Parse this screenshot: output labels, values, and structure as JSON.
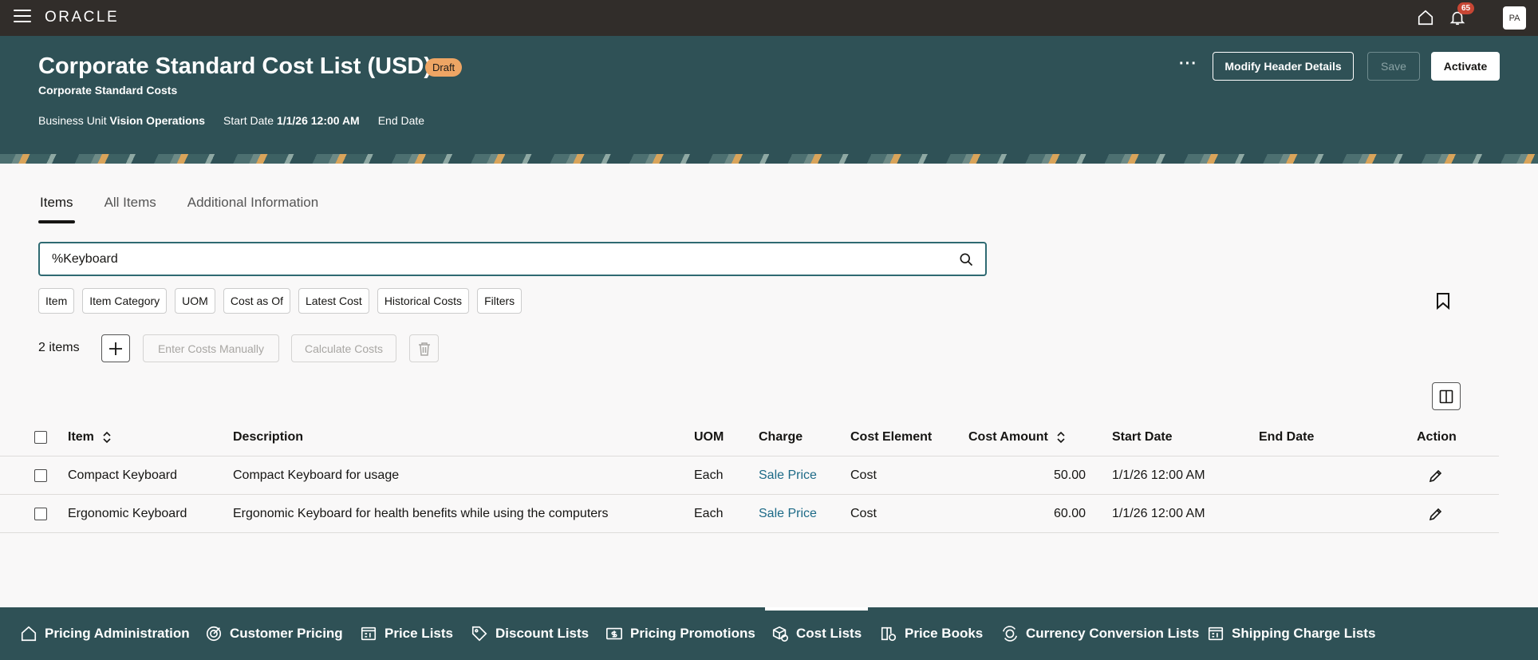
{
  "app": {
    "logo": "ORACLE",
    "notifications_count": "65",
    "user_initials": "PA"
  },
  "header": {
    "title": "Corporate Standard Cost List (USD)",
    "status_badge": "Draft",
    "subtitle": "Corporate Standard Costs",
    "business_unit_label": "Business Unit",
    "business_unit_value": "Vision Operations",
    "start_date_label": "Start Date",
    "start_date_value": "1/1/26 12:00 AM",
    "end_date_label": "End Date",
    "more_label": "···",
    "modify_button": "Modify Header Details",
    "save_button": "Save",
    "activate_button": "Activate"
  },
  "tabs": [
    {
      "label": "Items",
      "active": true
    },
    {
      "label": "All Items",
      "active": false
    },
    {
      "label": "Additional Information",
      "active": false
    }
  ],
  "search": {
    "value": "%Keyboard",
    "placeholder": ""
  },
  "filters": [
    "Item",
    "Item Category",
    "UOM",
    "Cost as Of",
    "Latest Cost",
    "Historical Costs",
    "Filters"
  ],
  "toolbar": {
    "count_label": "2 items",
    "enter_costs_button": "Enter Costs Manually",
    "calculate_costs_button": "Calculate Costs"
  },
  "table": {
    "columns": {
      "item": "Item",
      "description": "Description",
      "uom": "UOM",
      "charge": "Charge",
      "cost_element": "Cost Element",
      "cost_amount": "Cost Amount",
      "start_date": "Start Date",
      "end_date": "End Date",
      "action": "Action"
    },
    "rows": [
      {
        "item": "Compact Keyboard",
        "description": "Compact Keyboard for usage",
        "uom": "Each",
        "charge": "Sale Price",
        "cost_element": "Cost",
        "cost_amount": "50.00",
        "start_date": "1/1/26 12:00 AM",
        "end_date": ""
      },
      {
        "item": "Ergonomic Keyboard",
        "description": "Ergonomic Keyboard for health benefits while using the computers",
        "uom": "Each",
        "charge": "Sale Price",
        "cost_element": "Cost",
        "cost_amount": "60.00",
        "start_date": "1/1/26 12:00 AM",
        "end_date": ""
      }
    ]
  },
  "bottom_nav": [
    {
      "label": "Pricing Administration",
      "icon": "home-icon",
      "active": false
    },
    {
      "label": "Customer Pricing",
      "icon": "target-icon",
      "active": false
    },
    {
      "label": "Price Lists",
      "icon": "price-list-icon",
      "active": false
    },
    {
      "label": "Discount Lists",
      "icon": "tag-icon",
      "active": false
    },
    {
      "label": "Pricing Promotions",
      "icon": "dollar-bill-icon",
      "active": false
    },
    {
      "label": "Cost Lists",
      "icon": "cost-box-icon",
      "active": true
    },
    {
      "label": "Price Books",
      "icon": "book-icon",
      "active": false
    },
    {
      "label": "Currency Conversion Lists",
      "icon": "currency-icon",
      "active": false
    },
    {
      "label": "Shipping Charge Lists",
      "icon": "shipping-list-icon",
      "active": false
    }
  ],
  "colors": {
    "topbar": "#312d2a",
    "header": "#2f5156",
    "draft_badge": "#eea564",
    "link": "#1d6a87",
    "notification_badge": "#c74634"
  }
}
